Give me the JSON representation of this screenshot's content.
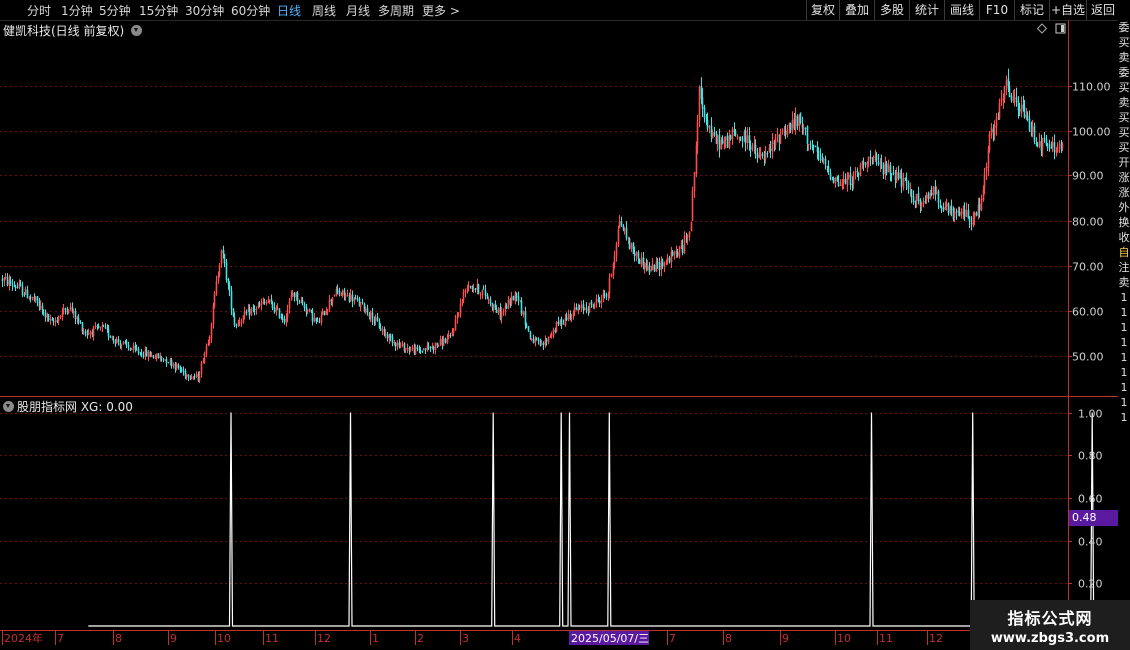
{
  "toolbar": {
    "periods": [
      "分时",
      "1分钟",
      "5分钟",
      "15分钟",
      "30分钟",
      "60分钟",
      "日线",
      "周线",
      "月线",
      "多周期",
      "更多 >"
    ],
    "active_period": "日线",
    "right_buttons": [
      "复权",
      "叠加",
      "多股",
      "统计",
      "画线",
      "F10",
      "标记",
      "+自选",
      "返回"
    ]
  },
  "main_panel": {
    "title": "健凯科技(日线 前复权)"
  },
  "indicator_panel": {
    "title": "股朋指标网 XG: 0.00",
    "badge": "0.48"
  },
  "x_axis": {
    "labels": [
      "2024年",
      "7",
      "8",
      "9",
      "10",
      "11",
      "12",
      "1",
      "2",
      "3",
      "4",
      "2025/05/07/三",
      "7",
      "8",
      "9",
      "10",
      "11",
      "12"
    ]
  },
  "right_column_text": [
    "委",
    "买",
    "卖",
    "委",
    "买",
    "卖",
    "买",
    "买",
    "买",
    "开",
    "涨",
    "涨",
    "外",
    "换",
    "收",
    "自",
    "注",
    "卖",
    "1",
    "1",
    "1",
    "1",
    "1",
    "1",
    "1",
    "1",
    "1"
  ],
  "watermark": {
    "title": "指标公式网",
    "url": "www.zbgs3.com"
  },
  "colors": {
    "up": "#ff4d4d",
    "down": "#48e0e0",
    "grid": "#6a0f0f",
    "signal": "#ffffff",
    "axis": "#c03030"
  },
  "chart_data": [
    {
      "type": "candlestick",
      "title": "",
      "ylim": [
        41,
        121
      ],
      "y_ticks": [
        50,
        60,
        70,
        80,
        90,
        100,
        110
      ],
      "y_tick_labels": [
        "50.00",
        "60.00",
        "70.00",
        "80.00",
        "90.00",
        "100.00",
        "110.00"
      ],
      "grid": true,
      "trend_points": [
        [
          0,
          67
        ],
        [
          10,
          65
        ],
        [
          20,
          62
        ],
        [
          30,
          57
        ],
        [
          40,
          61
        ],
        [
          50,
          55
        ],
        [
          60,
          56
        ],
        [
          70,
          53
        ],
        [
          80,
          51
        ],
        [
          90,
          50
        ],
        [
          100,
          49
        ],
        [
          110,
          46
        ],
        [
          118,
          45
        ],
        [
          125,
          55
        ],
        [
          132,
          74
        ],
        [
          140,
          57
        ],
        [
          150,
          60
        ],
        [
          160,
          62
        ],
        [
          170,
          58
        ],
        [
          175,
          64
        ],
        [
          180,
          62
        ],
        [
          190,
          57
        ],
        [
          200,
          64
        ],
        [
          210,
          63
        ],
        [
          220,
          60
        ],
        [
          230,
          55
        ],
        [
          240,
          52
        ],
        [
          250,
          51
        ],
        [
          260,
          52
        ],
        [
          270,
          54
        ],
        [
          280,
          66
        ],
        [
          290,
          64
        ],
        [
          300,
          59
        ],
        [
          310,
          64
        ],
        [
          318,
          54
        ],
        [
          325,
          52
        ],
        [
          335,
          57
        ],
        [
          345,
          60
        ],
        [
          355,
          61
        ],
        [
          365,
          64
        ],
        [
          372,
          80
        ],
        [
          380,
          73
        ],
        [
          390,
          69
        ],
        [
          400,
          71
        ],
        [
          410,
          74
        ],
        [
          415,
          80
        ],
        [
          420,
          108
        ],
        [
          428,
          98
        ],
        [
          435,
          97
        ],
        [
          440,
          99
        ],
        [
          450,
          98
        ],
        [
          455,
          94
        ],
        [
          460,
          94
        ],
        [
          470,
          100
        ],
        [
          480,
          102
        ],
        [
          490,
          95
        ],
        [
          500,
          90
        ],
        [
          505,
          88
        ],
        [
          515,
          90
        ],
        [
          520,
          94
        ],
        [
          530,
          92
        ],
        [
          540,
          90
        ],
        [
          545,
          87
        ],
        [
          555,
          83
        ],
        [
          560,
          87
        ],
        [
          570,
          82
        ],
        [
          575,
          81
        ],
        [
          580,
          82
        ],
        [
          585,
          80
        ],
        [
          590,
          84
        ],
        [
          595,
          98
        ],
        [
          600,
          103
        ],
        [
          605,
          110
        ],
        [
          610,
          106
        ],
        [
          615,
          104
        ],
        [
          625,
          97
        ],
        [
          635,
          96
        ],
        [
          640,
          97
        ]
      ]
    },
    {
      "type": "line",
      "title": "",
      "series": [
        {
          "name": "XG",
          "last_value": 0.0
        }
      ],
      "ylim": [
        0,
        1.04
      ],
      "y_ticks": [
        0.2,
        0.4,
        0.6,
        0.8,
        1.0
      ],
      "y_tick_labels": [
        "0.20",
        "0.40",
        "0.60",
        "0.80",
        "1.00"
      ],
      "signal_days": [
        138,
        210,
        296,
        337,
        342,
        366,
        524,
        585,
        657
      ],
      "signal_value": 1.0,
      "days_total": 640
    }
  ]
}
